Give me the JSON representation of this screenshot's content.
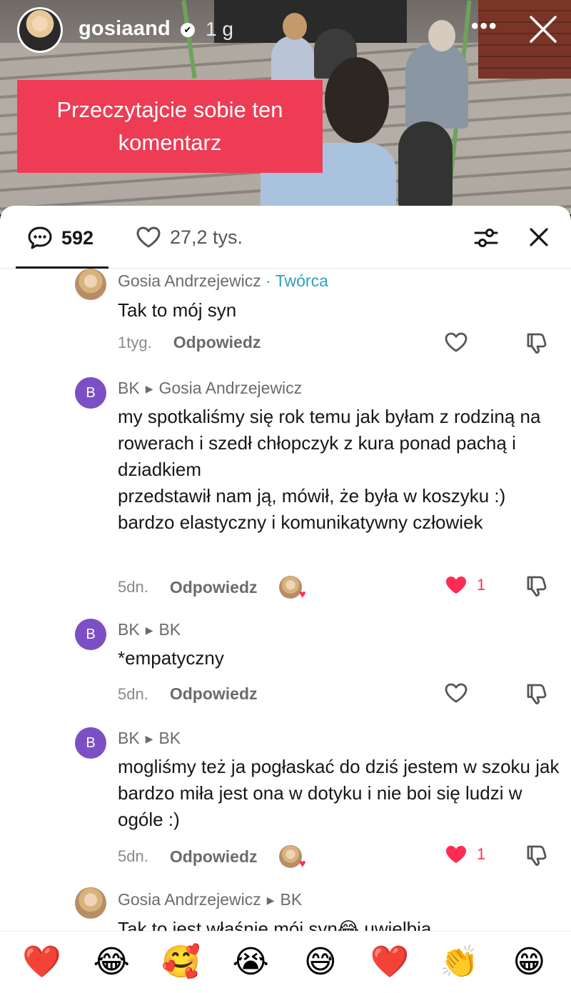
{
  "story": {
    "username": "gosiaand",
    "verified_mark": "✔",
    "time_ago": "1 g",
    "more_label": "•••",
    "caption": "Przeczytajcie sobie ten komentarz"
  },
  "sheet": {
    "comment_count": "592",
    "like_count": "27,2 tys."
  },
  "comments": [
    {
      "author": "Gosia Andrzejewicz",
      "creator_label": "· Twórca",
      "text": "Tak to mój syn",
      "time": "1tyg.",
      "reply_label": "Odpowiedz",
      "liked": false
    },
    {
      "avatar_letter": "B",
      "author": "BK",
      "reply_to": "Gosia Andrzejewicz",
      "text": "my spotkaliśmy się rok temu jak byłam z rodziną na rowerach i szedł chłopczyk z kura ponad pachą i dziadkiem\nprzedstawił nam ją, mówił, że była w koszyku :) bardzo elastyczny i komunikatywny człowiek",
      "time": "5dn.",
      "reply_label": "Odpowiedz",
      "liked": true,
      "like_count": "1"
    },
    {
      "avatar_letter": "B",
      "author": "BK",
      "reply_to": "BK",
      "text": "*empatyczny",
      "time": "5dn.",
      "reply_label": "Odpowiedz",
      "liked": false
    },
    {
      "avatar_letter": "B",
      "author": "BK",
      "reply_to": "BK",
      "text": "mogliśmy też ja pogłaskać do dziś jestem w szoku jak bardzo miła jest ona w dotyku i nie boi się ludzi w ogóle :)",
      "time": "5dn.",
      "reply_label": "Odpowiedz",
      "liked": true,
      "like_count": "1"
    },
    {
      "author": "Gosia Andrzejewicz",
      "reply_to": "BK",
      "text": "Tak to jest właśnie mój syn😂 uwielbia"
    }
  ],
  "reactions": [
    "❤️",
    "😂",
    "🥰",
    "😭",
    "😅",
    "❤️",
    "👏",
    "😁"
  ],
  "colors": {
    "caption_bg": "#ee3c55",
    "creator_badge": "#2aa2c4",
    "like_red": "#fe2c55",
    "avatar_purple": "#7d4fc4"
  }
}
